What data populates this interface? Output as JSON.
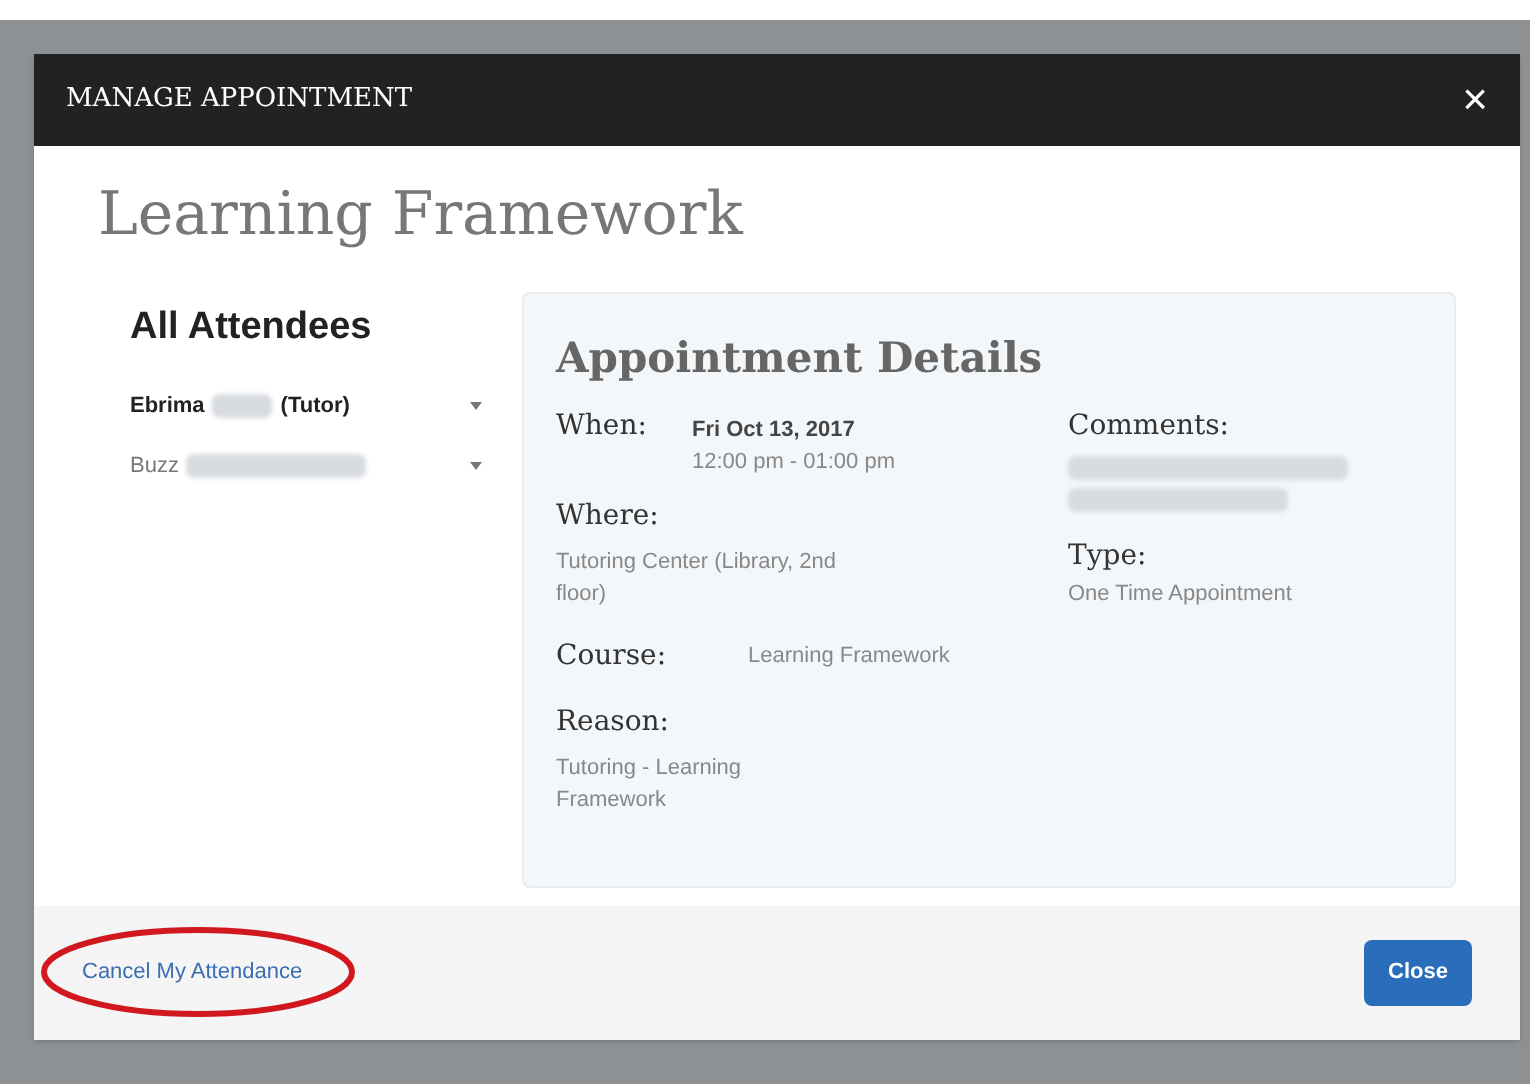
{
  "modal": {
    "title": "MANAGE APPOINTMENT",
    "close_glyph": "×",
    "heading": "Learning Framework"
  },
  "attendees": {
    "heading": "All Attendees",
    "items": [
      {
        "first_name": "Ebrima",
        "role": "(Tutor)",
        "bold": true,
        "redacted": true
      },
      {
        "first_name": "Buzz",
        "bold": false,
        "redacted": true
      }
    ]
  },
  "details": {
    "heading": "Appointment Details",
    "when": {
      "label": "When:",
      "date": "Fri Oct 13, 2017",
      "time": "12:00 pm - 01:00 pm"
    },
    "where": {
      "label": "Where:",
      "value": "Tutoring Center (Library, 2nd floor)"
    },
    "course": {
      "label": "Course:",
      "value": "Learning Framework"
    },
    "reason": {
      "label": "Reason:",
      "value": "Tutoring - Learning Framework"
    },
    "comments": {
      "label": "Comments:",
      "redacted": true
    },
    "type": {
      "label": "Type:",
      "value": "One Time Appointment"
    }
  },
  "footer": {
    "cancel_link": "Cancel My Attendance",
    "cancel_highlighted": true,
    "close_button": "Close"
  }
}
